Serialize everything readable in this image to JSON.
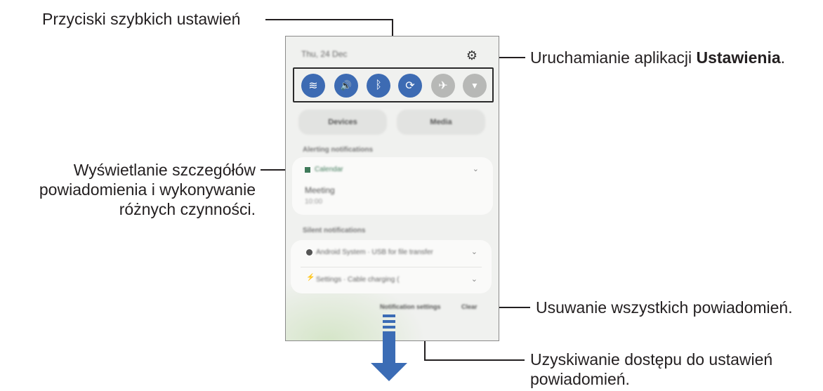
{
  "callouts": {
    "quick_settings": "Przyciski szybkich ustawień",
    "settings_app_prefix": "Uruchamianie aplikacji ",
    "settings_app_bold": "Ustawienia",
    "settings_app_suffix": ".",
    "notification_details_line1": "Wyświetlanie szczegółów",
    "notification_details_line2": "powiadomienia i wykonywanie",
    "notification_details_line3": "różnych czynności.",
    "clear_all": "Usuwanie wszystkich powiadomień.",
    "notif_settings_line1": "Uzyskiwanie dostępu do ustawień",
    "notif_settings_line2": "powiadomień."
  },
  "phone": {
    "date": "Thu, 24 Dec",
    "settings_icon": "gear-icon",
    "quick_buttons": [
      {
        "icon": "wifi-icon",
        "state": "on",
        "glyph": "≋"
      },
      {
        "icon": "sound-icon",
        "state": "on",
        "glyph": "🔊"
      },
      {
        "icon": "bluetooth-icon",
        "state": "on",
        "glyph": "ᛒ"
      },
      {
        "icon": "auto-rotate-icon",
        "state": "on",
        "glyph": "⟳"
      },
      {
        "icon": "airplane-icon",
        "state": "off",
        "glyph": "✈"
      },
      {
        "icon": "flashlight-icon",
        "state": "off",
        "glyph": "▼"
      }
    ],
    "devices_label": "Devices",
    "media_label": "Media",
    "alerting_label": "Alerting notifications",
    "calendar_app": "Calendar",
    "meeting_title": "Meeting",
    "meeting_time": "10:00",
    "silent_label": "Silent notifications",
    "android_system_row": "Android System · USB for file transfer",
    "settings_row": "Settings · Cable charging (",
    "notification_settings_link": "Notification settings",
    "clear_link": "Clear"
  },
  "colors": {
    "accent_blue": "#3d6bb3",
    "arrow_blue": "#3b6cb5"
  }
}
